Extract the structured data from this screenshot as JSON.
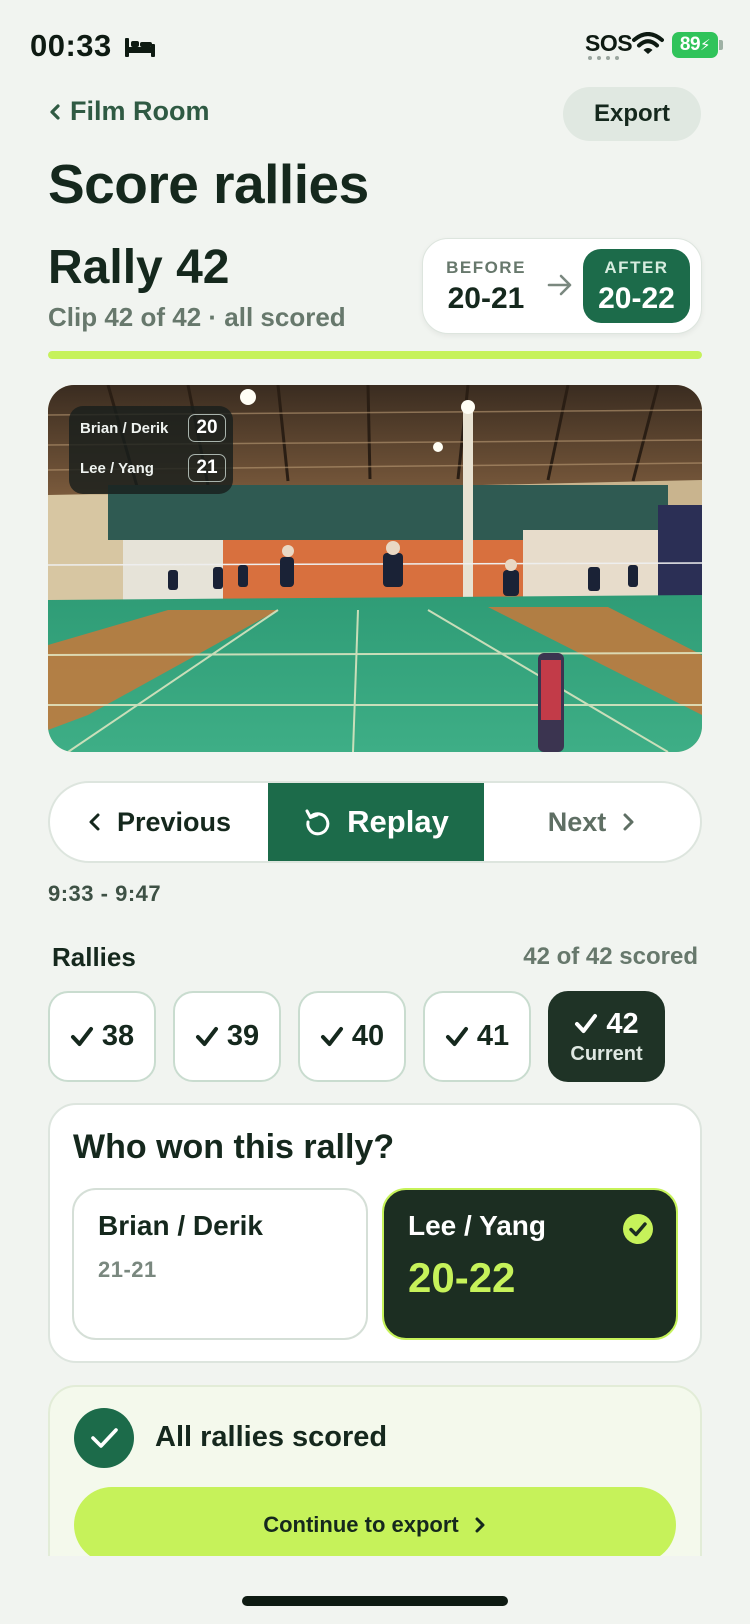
{
  "status_bar": {
    "time": "00:33",
    "sos": "SOS",
    "battery": "89"
  },
  "nav": {
    "back_label": "Film Room",
    "export_label": "Export"
  },
  "page_title": "Score rallies",
  "rally": {
    "title": "Rally 42",
    "subtitle": "Clip 42 of 42 · all scored",
    "before_label": "BEFORE",
    "before_score": "20-21",
    "after_label": "AFTER",
    "after_score": "20-22",
    "progress": 1.0
  },
  "video_overlay": {
    "team1_name": "Brian / Derik",
    "team1_score": "20",
    "team2_name": "Lee / Yang",
    "team2_score": "21"
  },
  "controls": {
    "previous_label": "Previous",
    "replay_label": "Replay",
    "next_label": "Next"
  },
  "time_range": "9:33 - 9:47",
  "rallies": {
    "title": "Rallies",
    "count_label": "42 of 42 scored",
    "chips": [
      "38",
      "39",
      "40",
      "41",
      "42"
    ],
    "current_label": "Current"
  },
  "winner": {
    "question": "Who won this rally?",
    "team_a_name": "Brian / Derik",
    "team_a_score": "21-21",
    "team_b_name": "Lee / Yang",
    "team_b_score": "20-22"
  },
  "scored": {
    "message": "All rallies scored",
    "continue_label": "Continue to export"
  },
  "colors": {
    "accent": "#1c6b4a",
    "lime": "#c6f25a",
    "dark": "#1c2e22",
    "background": "#f1f4f0"
  }
}
